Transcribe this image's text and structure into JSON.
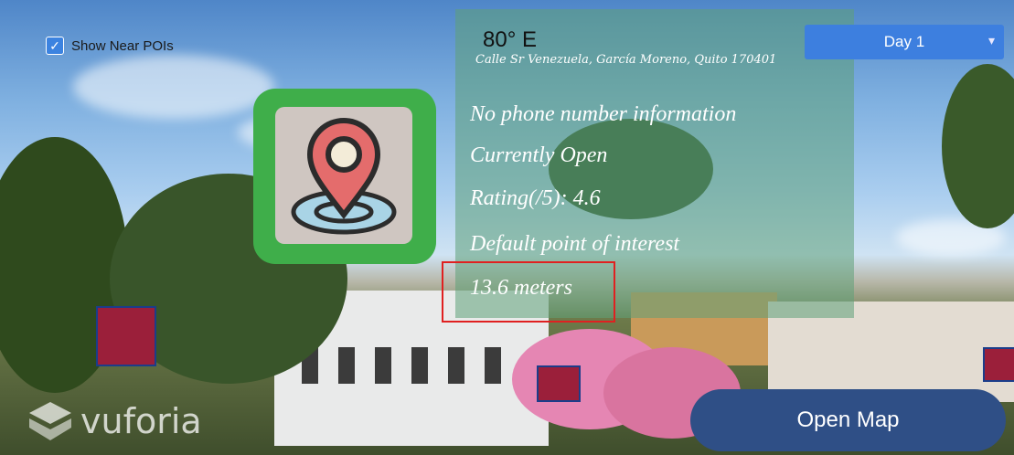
{
  "toggle": {
    "label": "Show Near POIs",
    "checked": true
  },
  "compass": {
    "bearing": "80° E"
  },
  "poi": {
    "address": "Calle Sr Venezuela, García Moreno, Quito 170401",
    "phone": "No phone number information",
    "status": "Currently Open",
    "rating": "Rating(/5): 4.6",
    "category": "Default point of interest",
    "distance": "13.6 meters",
    "icon": "map-pin-icon"
  },
  "day_selector": {
    "selected": "Day 1"
  },
  "branding": {
    "name": "vuforia"
  },
  "actions": {
    "open_map_label": "Open Map"
  },
  "colors": {
    "dropdown": "#3d7fdf",
    "poi_card": "#3fae4a",
    "button": "#2f4f86",
    "highlight": "#e02020"
  }
}
